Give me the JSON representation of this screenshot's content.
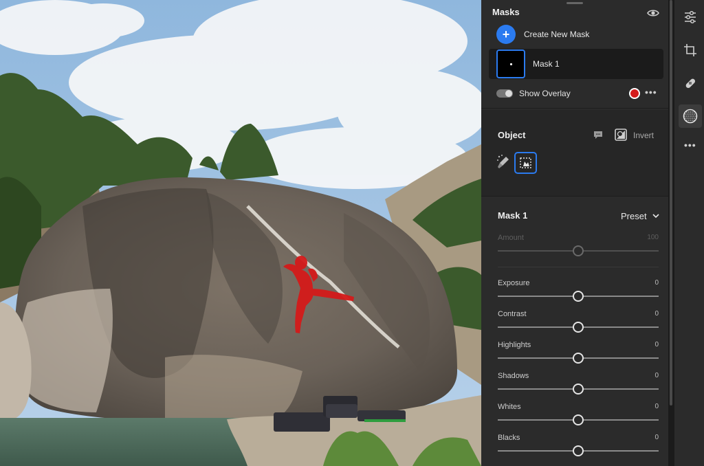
{
  "masks_panel": {
    "title": "Masks",
    "create_label": "Create New Mask",
    "create_icon": "+",
    "mask_name": "Mask 1",
    "show_overlay_label": "Show Overlay",
    "overlay_enabled": true,
    "overlay_color": "#d41a1a",
    "more_label": "•••"
  },
  "object_section": {
    "title": "Object",
    "invert_label": "Invert"
  },
  "adjustments": {
    "title": "Mask 1",
    "preset_label": "Preset",
    "amount": {
      "label": "Amount",
      "value": "100"
    },
    "sliders": [
      {
        "label": "Exposure",
        "value": "0"
      },
      {
        "label": "Contrast",
        "value": "0"
      },
      {
        "label": "Highlights",
        "value": "0"
      },
      {
        "label": "Shadows",
        "value": "0"
      },
      {
        "label": "Whites",
        "value": "0"
      },
      {
        "label": "Blacks",
        "value": "0"
      }
    ]
  },
  "toolbar": {
    "items": [
      "sliders-icon",
      "crop-icon",
      "bandage-icon",
      "masking-icon"
    ],
    "active": "masking-icon",
    "more_label": "•••"
  },
  "colors": {
    "accent": "#2b7bf0",
    "panel_bg": "#2b2b2b",
    "mask_overlay": "#d41a1a"
  }
}
